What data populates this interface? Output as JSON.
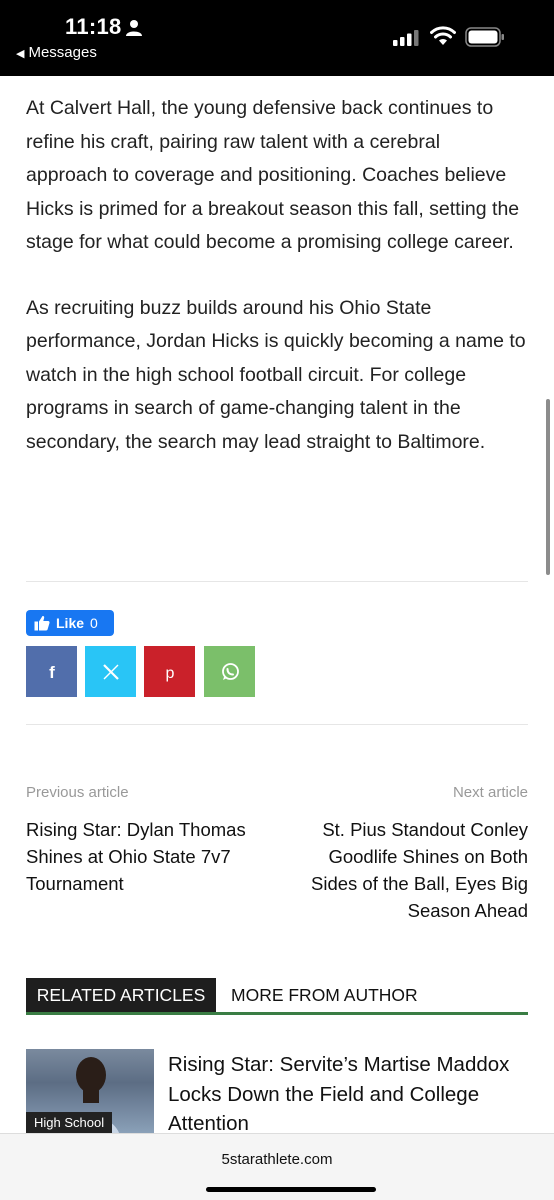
{
  "status_bar": {
    "time": "11:18",
    "back_label": "Messages"
  },
  "article": {
    "paragraphs": [
      "At Calvert Hall, the young defensive back continues to refine his craft, pairing raw talent with a cerebral approach to coverage and positioning. Coaches believe Hicks is primed for a breakout season this fall, setting the stage for what could become a promising college career.",
      "As recruiting buzz builds around his Ohio State performance, Jordan Hicks is quickly becoming a name to watch in the high school football circuit. For college programs in search of game-changing talent in the secondary, the search may lead straight to Baltimore."
    ]
  },
  "like": {
    "label": "Like",
    "count": "0"
  },
  "share_buttons": [
    {
      "icon": "facebook-icon",
      "color": "#516eab"
    },
    {
      "icon": "x-icon",
      "color": "#29c5f6"
    },
    {
      "icon": "pinterest-icon",
      "color": "#ca212a"
    },
    {
      "icon": "whatsapp-icon",
      "color": "#7bbf6a"
    }
  ],
  "post_nav": {
    "prev_caption": "Previous article",
    "prev_title": "Rising Star: Dylan Thomas Shines at Ohio State 7v7 Tournament",
    "next_caption": "Next article",
    "next_title": "St. Pius Standout Conley Goodlife Shines on Both Sides of the Ball, Eyes Big Season Ahead"
  },
  "tabs": {
    "active": "RELATED ARTICLES",
    "other": "MORE FROM AUTHOR"
  },
  "related": {
    "category": "High School",
    "title": "Rising Star: Servite’s Martise Maddox Locks Down the Field and College Attention"
  },
  "browser": {
    "url": "5starathlete.com"
  },
  "colors": {
    "accent_green": "#3a7d44",
    "like_blue": "#1877f2"
  }
}
